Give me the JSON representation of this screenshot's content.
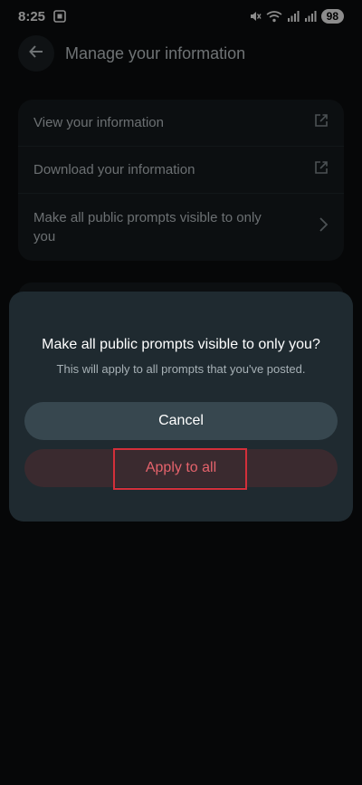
{
  "status_bar": {
    "time": "8:25",
    "battery": "98",
    "icons": [
      "screenshot-icon",
      "mute-icon",
      "wifi-icon",
      "signal-icon",
      "signal-icon-2"
    ]
  },
  "header": {
    "title": "Manage your information",
    "back_icon": "arrow-left-icon"
  },
  "menu": {
    "items": [
      {
        "label": "View your information",
        "icon": "external-link-icon"
      },
      {
        "label": "Download your information",
        "icon": "external-link-icon"
      },
      {
        "label": "Make all public prompts visible to only you",
        "icon": "chevron-right-icon"
      }
    ]
  },
  "dialog": {
    "title": "Make all public prompts visible to only you?",
    "subtitle": "This will apply to all prompts that you've posted.",
    "cancel_label": "Cancel",
    "apply_label": "Apply to all"
  },
  "colors": {
    "background": "#0b0d0f",
    "card": "#171c1f",
    "dialog": "#1f2a30",
    "cancel_button": "#37474f",
    "apply_text": "#e5636c",
    "highlight": "#d32f3a"
  }
}
